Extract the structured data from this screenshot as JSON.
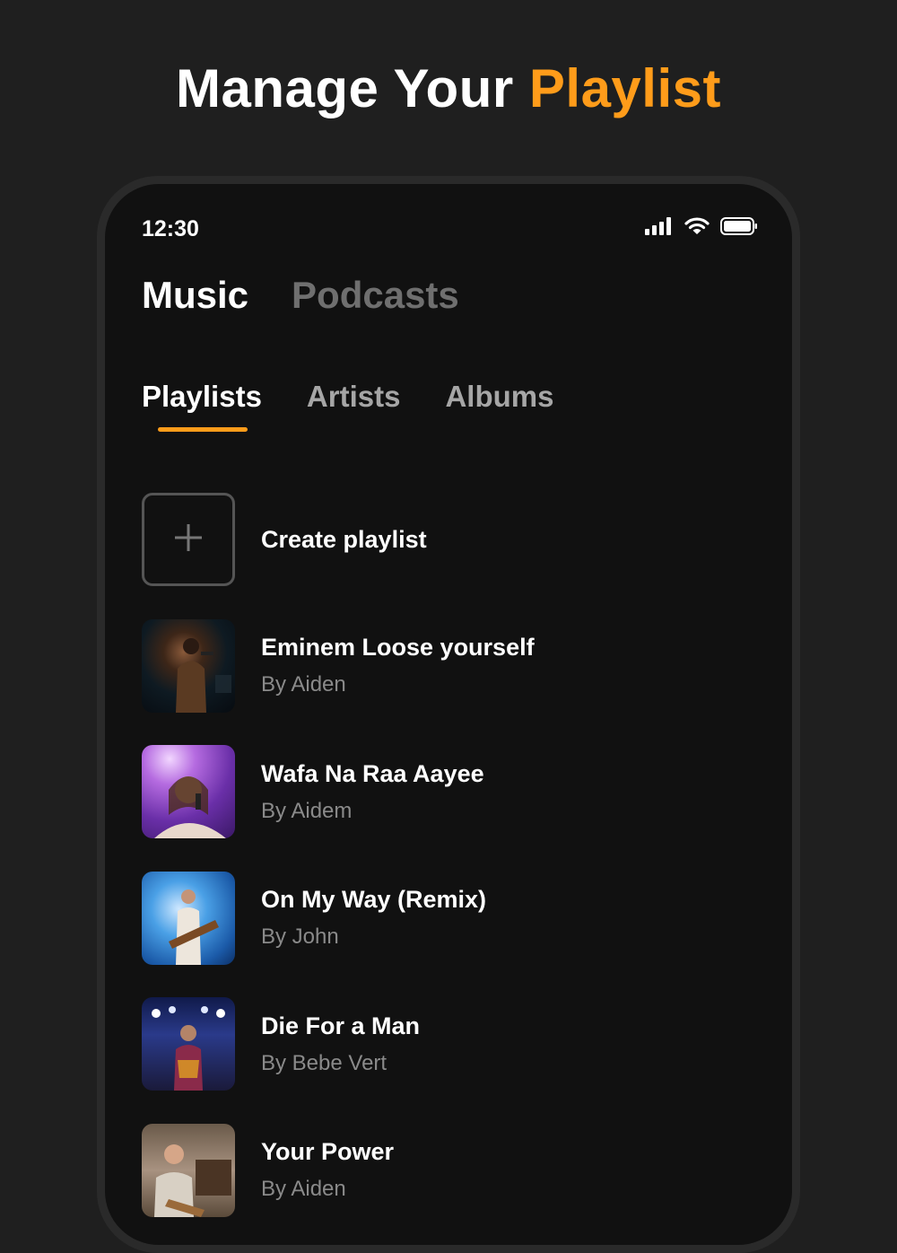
{
  "hero": {
    "title_plain": "Manage Your",
    "title_accent": "Playlist",
    "accent_color": "#ff9c1a"
  },
  "status_bar": {
    "time": "12:30",
    "icons": [
      "signal-icon",
      "wifi-icon",
      "battery-icon"
    ]
  },
  "top_tabs": [
    {
      "label": "Music",
      "active": true
    },
    {
      "label": "Podcasts",
      "active": false
    }
  ],
  "sub_tabs": [
    {
      "label": "Playlists",
      "active": true
    },
    {
      "label": "Artists",
      "active": false
    },
    {
      "label": "Albums",
      "active": false
    }
  ],
  "create": {
    "label": "Create playlist",
    "icon": "plus-icon"
  },
  "playlists": [
    {
      "title": "Eminem Loose yourself",
      "author": "By Aiden"
    },
    {
      "title": "Wafa Na Raa Aayee",
      "author": "By Aidem"
    },
    {
      "title": "On My Way (Remix)",
      "author": "By John"
    },
    {
      "title": "Die For a Man",
      "author": "By Bebe Vert"
    },
    {
      "title": "Your Power",
      "author": "By Aiden"
    }
  ]
}
